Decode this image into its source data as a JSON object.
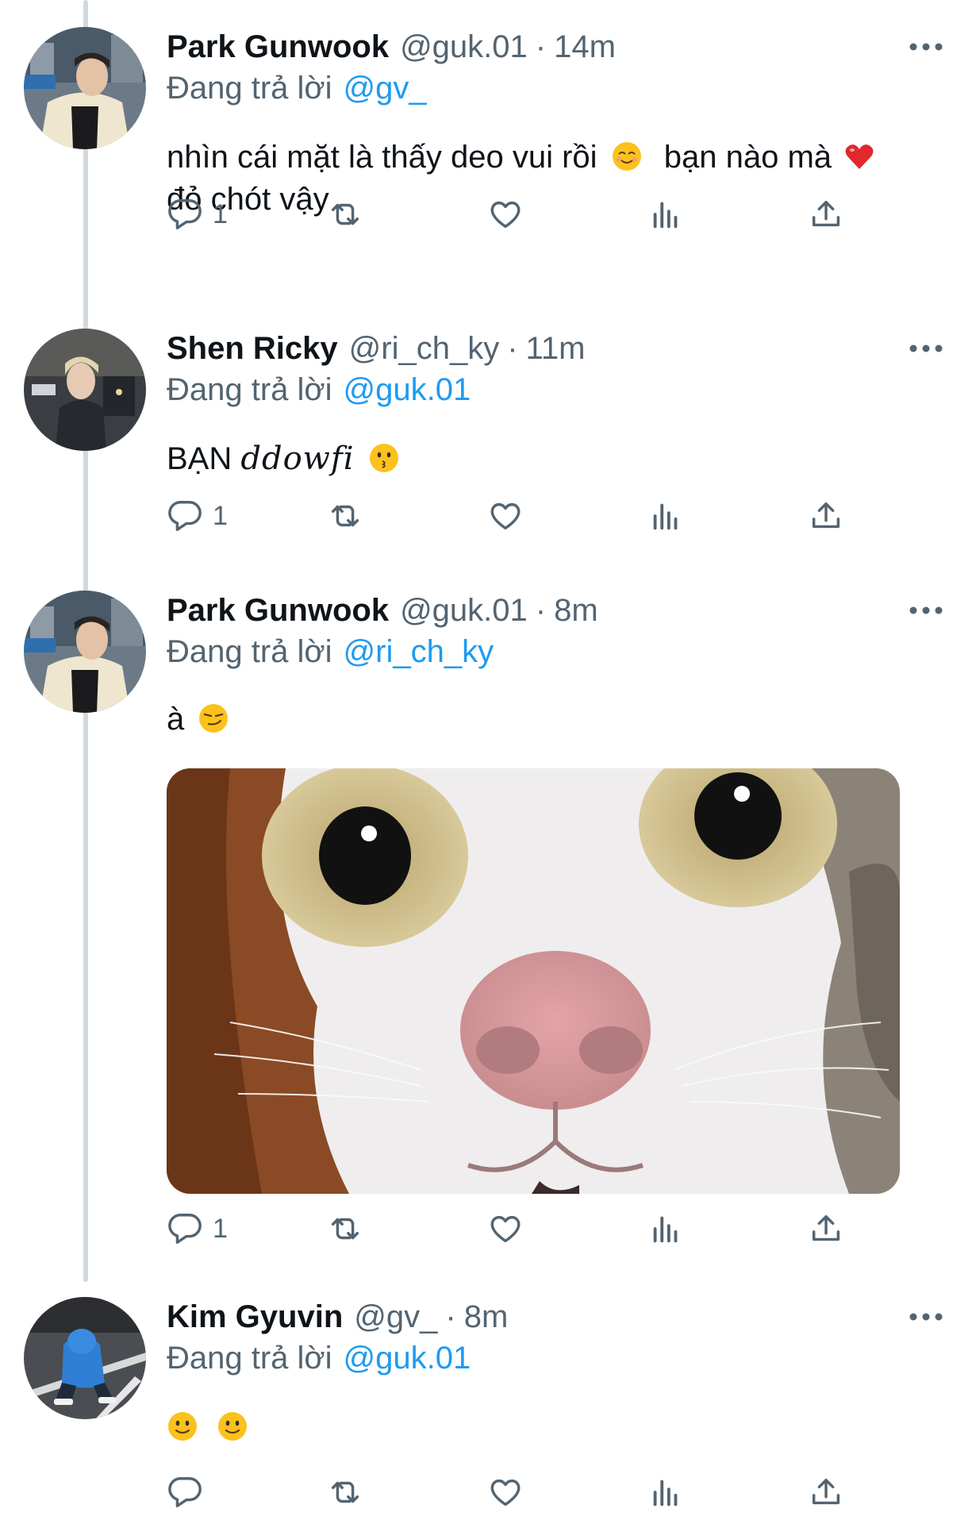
{
  "reply_prefix": "Đang trả lời",
  "tweets": [
    {
      "name": "Park Gunwook",
      "handle": "@guk.01",
      "sep": "·",
      "time": "14m",
      "reply_to": "@gv_",
      "text_line1": "nhìn cái mặt là thấy deo vui rồi",
      "text_mid": "bạn nào mà",
      "text_line2": "đỏ chót vậy",
      "reply_count": "1",
      "avatar_icon": "avatar-photo-man-jacket"
    },
    {
      "name": "Shen Ricky",
      "handle": "@ri_ch_ky",
      "sep": "·",
      "time": "11m",
      "reply_to": "@guk.01",
      "text_plain": "BẠN",
      "text_fancy": "ddowfi",
      "reply_count": "1",
      "avatar_icon": "avatar-photo-blond-man-street"
    },
    {
      "name": "Park Gunwook",
      "handle": "@guk.01",
      "sep": "·",
      "time": "8m",
      "reply_to": "@ri_ch_ky",
      "text": "à",
      "reply_count": "1",
      "media": "cat-closeup-photo",
      "avatar_icon": "avatar-photo-man-jacket"
    },
    {
      "name": "Kim Gyuvin",
      "handle": "@gv_",
      "sep": "·",
      "time": "8m",
      "reply_to": "@guk.01",
      "reply_count": "",
      "avatar_icon": "avatar-photo-blue-hoodie-crouching"
    }
  ],
  "icons": {
    "reply": "reply-icon",
    "retweet": "retweet-icon",
    "like": "like-icon",
    "views": "views-icon",
    "share": "share-icon",
    "more": "more-icon"
  },
  "colors": {
    "link": "#1d9bf0",
    "secondary": "#536471",
    "text": "#0f1419",
    "thread_line": "#cfd9de"
  }
}
